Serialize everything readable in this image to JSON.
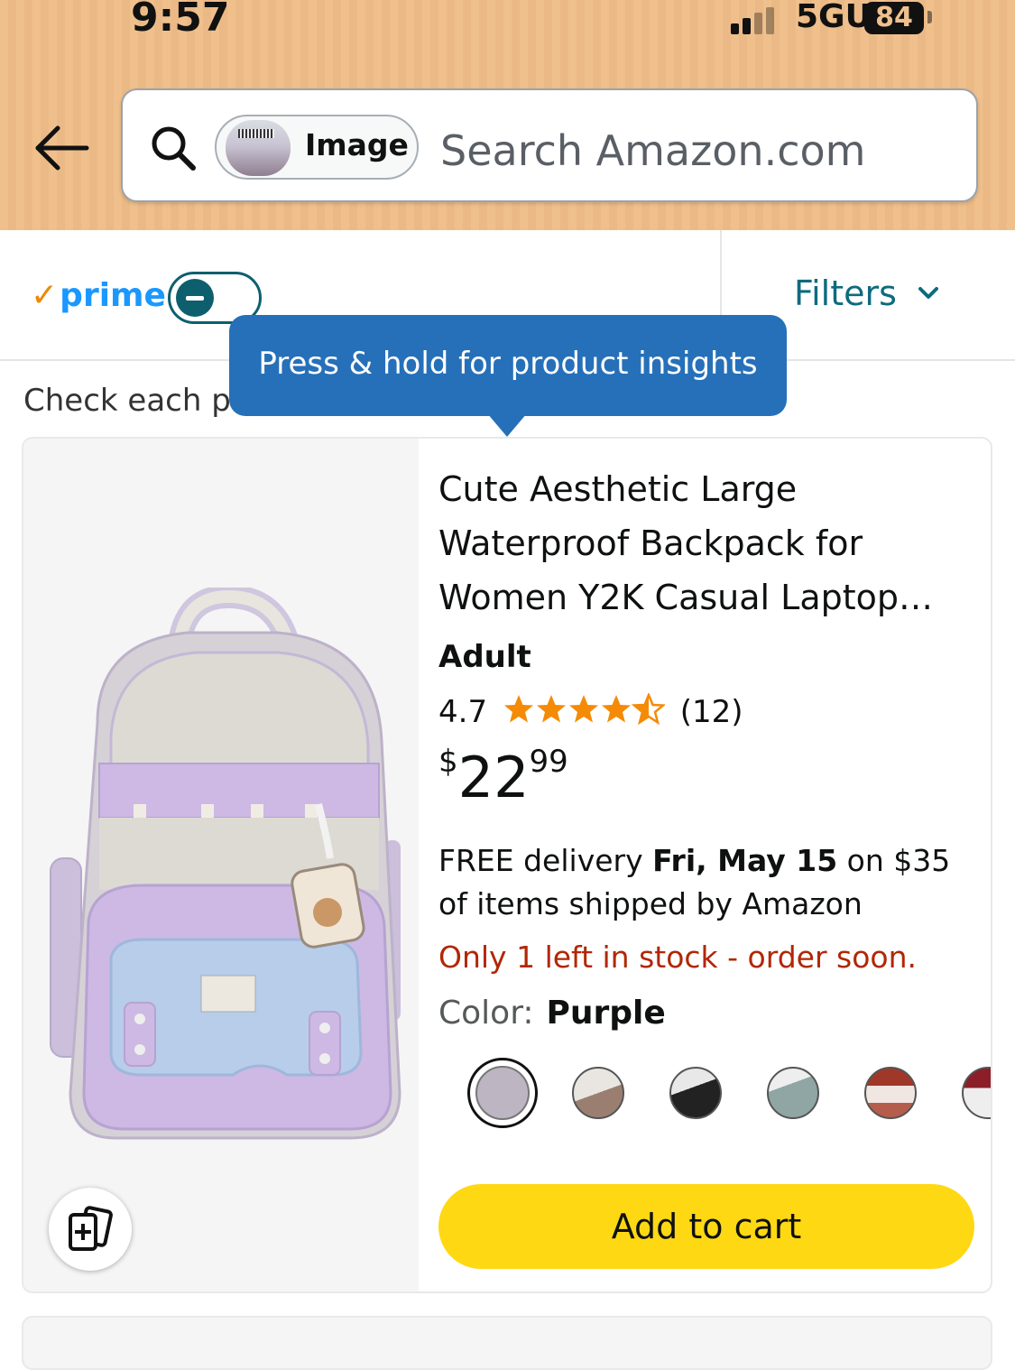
{
  "status_bar": {
    "time": "9:57",
    "network": "5GUC",
    "battery": "84"
  },
  "search": {
    "image_chip_label": "Image",
    "placeholder": "Search Amazon.com"
  },
  "prime_bar": {
    "prime_label": "prime",
    "filters_label": "Filters"
  },
  "info_text": "Check each pr",
  "tooltip": "Press & hold for product insights",
  "product": {
    "title_lines": [
      "Cute Aesthetic Large",
      "Waterproof Backpack for",
      "Women Y2K Casual Laptop…"
    ],
    "size": "Adult",
    "rating": "4.7",
    "rating_stars": 4.5,
    "review_count": "(12)",
    "price": {
      "symbol": "$",
      "whole": "22",
      "fraction": "99"
    },
    "delivery_pre": "FREE delivery ",
    "delivery_date": "Fri, May 15",
    "delivery_post": " on $35 of items shipped by Amazon",
    "stock": "Only 1 left in stock - order soon.",
    "color_label": "Color:",
    "color_value": "Purple",
    "swatch_colors": [
      "#bdb6c2",
      "#b7aea6",
      "#2a2a2a",
      "#9fb0ad",
      "#a0382a",
      "#8b1e28"
    ],
    "add_to_cart": "Add to cart"
  },
  "colors": {
    "prime_blue": "#1a98ff",
    "teal": "#0e6b7e",
    "tooltip_blue": "#2670b9",
    "cart_yellow": "#ffd814",
    "stock_red": "#b12704"
  }
}
